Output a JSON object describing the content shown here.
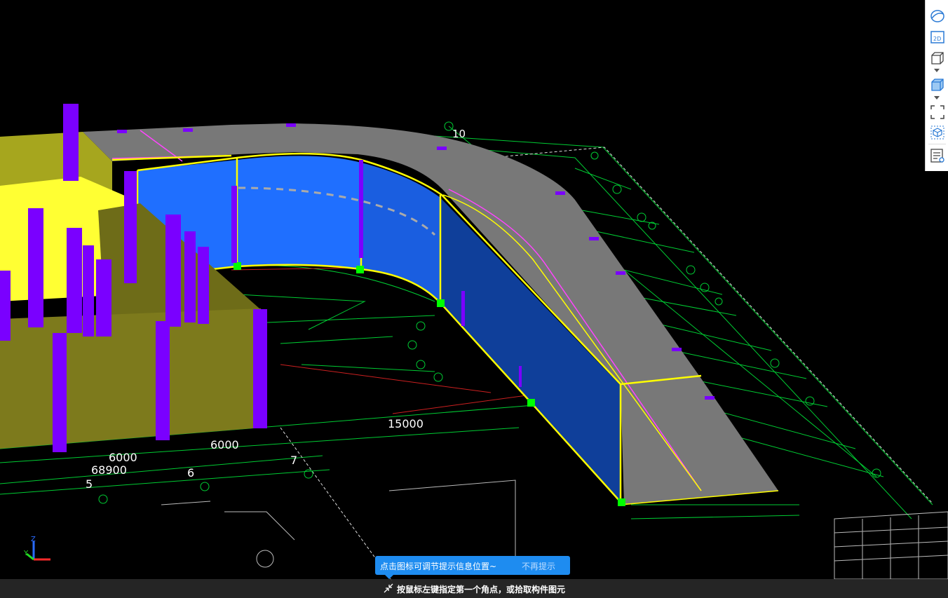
{
  "canvas": {
    "background": "#000000",
    "dimensions": [
      "10",
      "15000",
      "6000",
      "6000",
      "68900",
      "5",
      "6",
      "7"
    ]
  },
  "colors": {
    "wall_blue": "#1f6fff",
    "wall_dark_blue": "#0f3f9a",
    "slab_gray": "#787878",
    "column_purple": "#7a00ff",
    "wall_yellow": "#ffff33",
    "wall_olive": "#7d7a1c",
    "highlight_yellow": "#ffff00",
    "grip_green": "#00ff00",
    "cad_green": "#00cc33",
    "tip_blue": "#1e8cf0"
  },
  "toolbar": {
    "buttons": [
      {
        "icon": "orbit-icon"
      },
      {
        "icon": "view-2d-icon",
        "label": "2D"
      },
      {
        "icon": "view-3d-wireframe-icon"
      },
      {
        "icon": "view-3d-shaded-icon"
      },
      {
        "icon": "zoom-extents-icon"
      },
      {
        "icon": "component-visibility-icon"
      },
      {
        "icon": "display-settings-icon"
      }
    ]
  },
  "tip": {
    "text": "点击图标可调节提示信息位置~",
    "dismiss": "不再提示"
  },
  "status": {
    "icon": "pick-corner-icon",
    "text": "按鼠标左键指定第一个角点，或拾取构件图元"
  }
}
